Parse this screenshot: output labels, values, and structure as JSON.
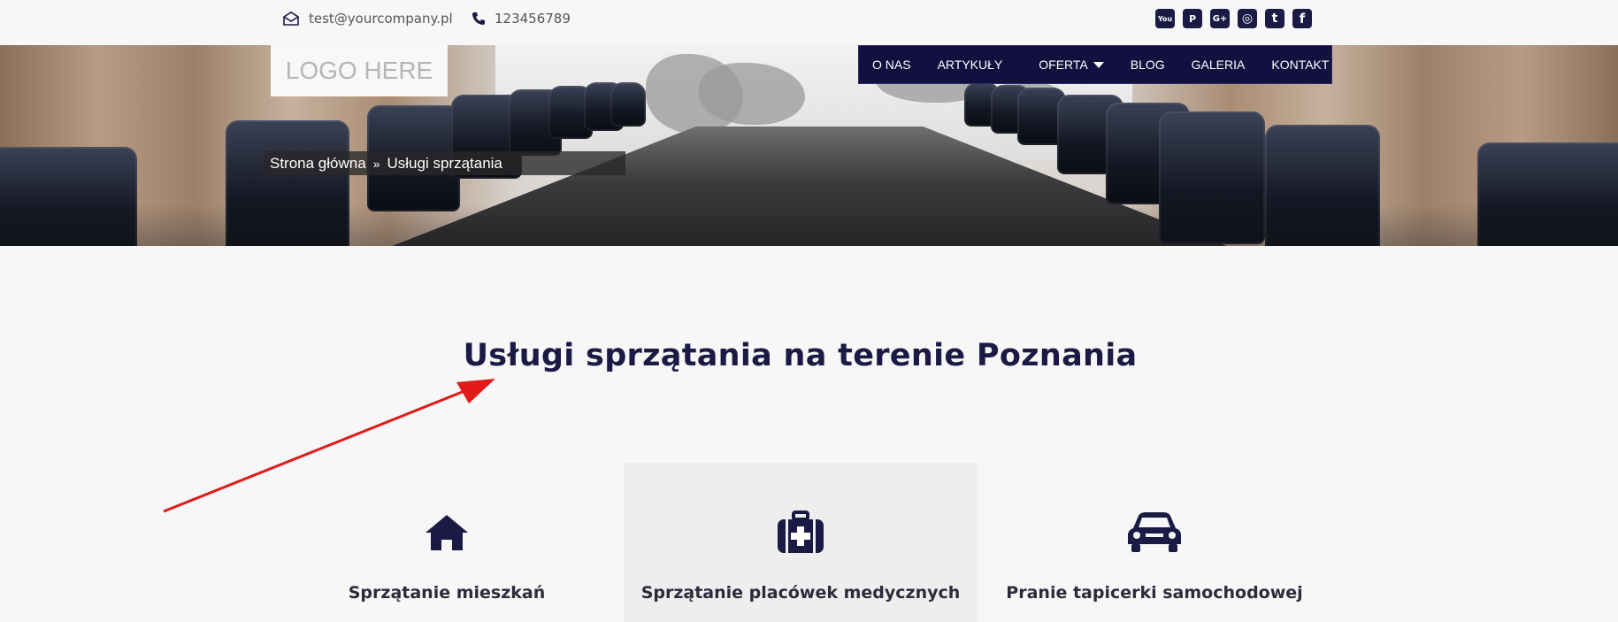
{
  "topbar": {
    "email": "test@yourcompany.pl",
    "phone": "123456789",
    "email_icon": "envelope-icon",
    "phone_icon": "phone-icon",
    "socials": [
      {
        "name": "youtube-icon",
        "glyph": "You"
      },
      {
        "name": "pinterest-icon",
        "glyph": "P"
      },
      {
        "name": "google-plus-icon",
        "glyph": "G+"
      },
      {
        "name": "instagram-icon",
        "glyph": "◎"
      },
      {
        "name": "twitter-icon",
        "glyph": "t"
      },
      {
        "name": "facebook-icon",
        "glyph": "f"
      }
    ]
  },
  "header": {
    "logo_text": "LOGO HERE",
    "nav": [
      "O NAS",
      "ARTYKUŁY",
      "OFERTA",
      "BLOG",
      "GALERIA",
      "KONTAKT"
    ]
  },
  "breadcrumb": {
    "home": "Strona główna",
    "separator": "»",
    "current": "Usługi sprzątania"
  },
  "main": {
    "title": "Usługi sprzątania na terenie Poznania",
    "services": [
      {
        "label": "Sprzątanie mieszkań",
        "icon": "house-icon"
      },
      {
        "label": "Sprzątanie placówek medycznych",
        "icon": "medkit-icon"
      },
      {
        "label": "Pranie tapicerki samochodowej",
        "icon": "car-icon"
      }
    ]
  },
  "colors": {
    "navy": "#1b1a45",
    "nav_bg": "#12103f",
    "arrow": "#e11a1a",
    "page_bg": "#f7f7f7"
  }
}
